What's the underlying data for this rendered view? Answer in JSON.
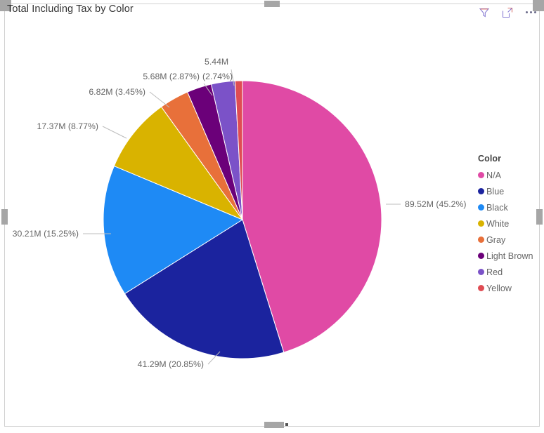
{
  "visual": {
    "title": "Total Including Tax by Color",
    "background": "#ffffff"
  },
  "header": {
    "icons": [
      {
        "name": "filter-icon",
        "label": "Filters"
      },
      {
        "name": "focus-mode-icon",
        "label": "Focus mode"
      },
      {
        "name": "more-options-icon",
        "label": "More options"
      }
    ]
  },
  "legend": {
    "title": "Color",
    "items": [
      {
        "label": "N/A",
        "color": "#E04AA5"
      },
      {
        "label": "Blue",
        "color": "#1B239E"
      },
      {
        "label": "Black",
        "color": "#1E8AF5"
      },
      {
        "label": "White",
        "color": "#D9B300"
      },
      {
        "label": "Gray",
        "color": "#E8703A"
      },
      {
        "label": "Light Brown",
        "color": "#6B0079"
      },
      {
        "label": "Red",
        "color": "#7B52C8"
      },
      {
        "label": "Yellow",
        "color": "#DF4C53"
      }
    ]
  },
  "chart_data": {
    "type": "pie",
    "title": "Total Including Tax by Color",
    "xlabel": "",
    "ylabel": "",
    "legend_position": "right",
    "legend_title": "Color",
    "value_unit": "M",
    "categories": [
      "N/A",
      "Blue",
      "Black",
      "White",
      "Gray",
      "Light Brown",
      "Red",
      "Yellow"
    ],
    "values": [
      89.52,
      41.29,
      30.21,
      17.37,
      6.82,
      5.68,
      5.44,
      1.7
    ],
    "percentages": [
      45.2,
      20.85,
      15.25,
      8.77,
      3.45,
      2.87,
      2.74,
      0.87
    ],
    "colors": [
      "#E04AA5",
      "#1B239E",
      "#1E8AF5",
      "#D9B300",
      "#E8703A",
      "#6B0079",
      "#7B52C8",
      "#DF4C53"
    ],
    "labels": [
      "89.52M (45.2%)",
      "41.29M (20.85%)",
      "30.21M (15.25%)",
      "17.37M (8.77%)",
      "6.82M (3.45%)",
      "5.68M (2.87%)",
      "5.44M",
      "(2.74%)"
    ]
  },
  "data_labels": {
    "na": "89.52M (45.2%)",
    "blue": "41.29M (20.85%)",
    "black": "30.21M (15.25%)",
    "white": "17.37M (8.77%)",
    "gray": "6.82M (3.45%)",
    "light_brown": "5.68M (2.87%)",
    "red_line1": "5.44M",
    "red_line2": "(2.74%)"
  }
}
